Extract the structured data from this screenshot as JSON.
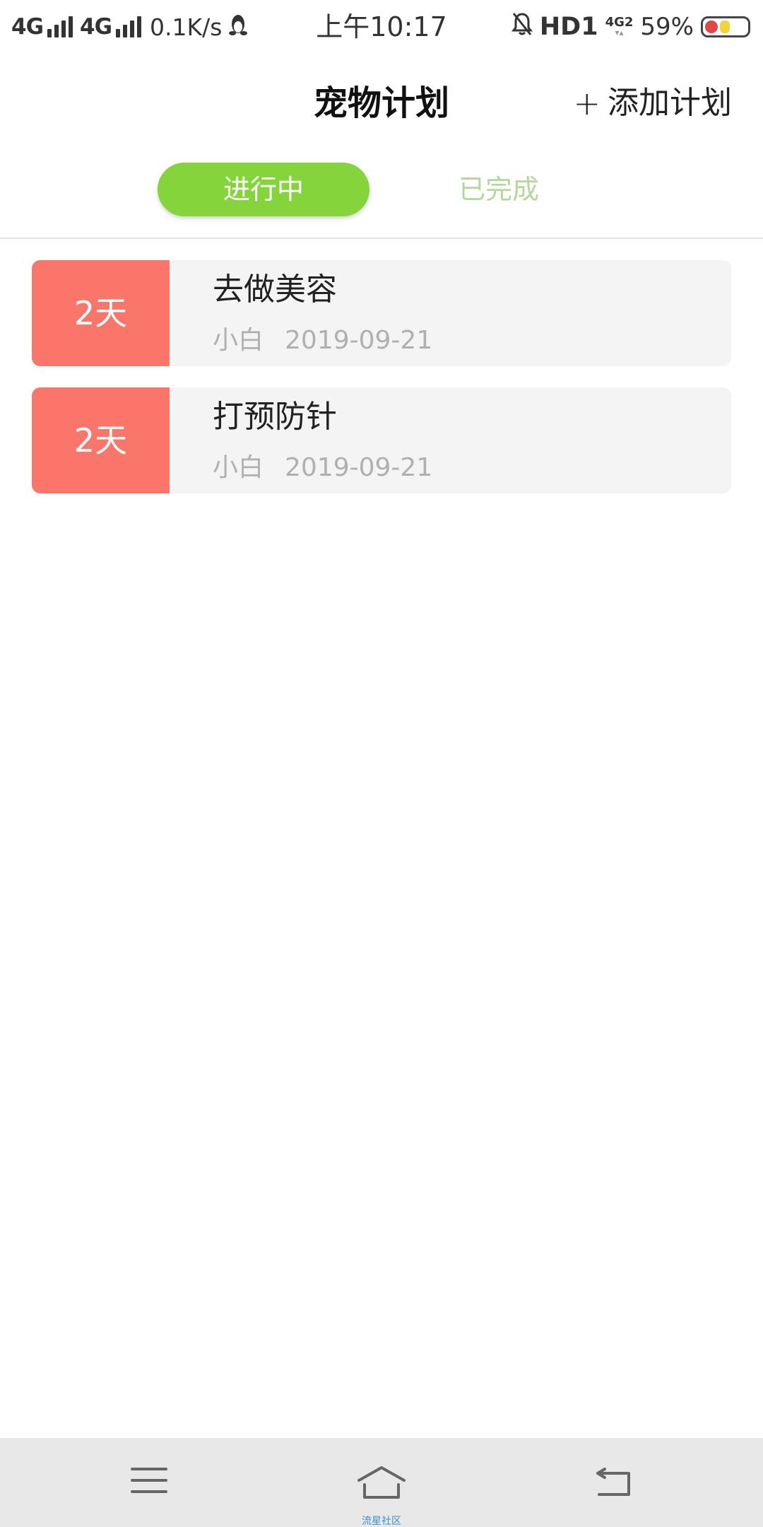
{
  "status_bar": {
    "net1": "4G",
    "net2": "4G",
    "speed": "0.1K/s",
    "time": "上午10:17",
    "hd": "HD1",
    "net3": "4G",
    "net3_sub": "2",
    "battery_pct": "59%",
    "icons": [
      "signal-icon",
      "qq-penguin-icon",
      "bell-off-icon",
      "battery-icon"
    ]
  },
  "header": {
    "title": "宠物计划",
    "add_plus": "+",
    "add_label": "添加计划"
  },
  "tabs": [
    {
      "label": "进行中",
      "active": true
    },
    {
      "label": "已完成",
      "active": false
    }
  ],
  "plans": [
    {
      "days": "2天",
      "title": "去做美容",
      "pet": "小白",
      "date": "2019-09-21"
    },
    {
      "days": "2天",
      "title": "打预防针",
      "pet": "小白",
      "date": "2019-09-21"
    }
  ],
  "bottom_nav": {
    "home_caption": "流星社区",
    "icons": [
      "menu-icon",
      "home-icon",
      "back-icon"
    ]
  },
  "colors": {
    "accent_green": "#86d43c",
    "inactive_tab": "#b5d89a",
    "badge_red": "#fa766b",
    "card_bg": "#f4f4f4",
    "nav_bg": "#e8e8e8"
  }
}
